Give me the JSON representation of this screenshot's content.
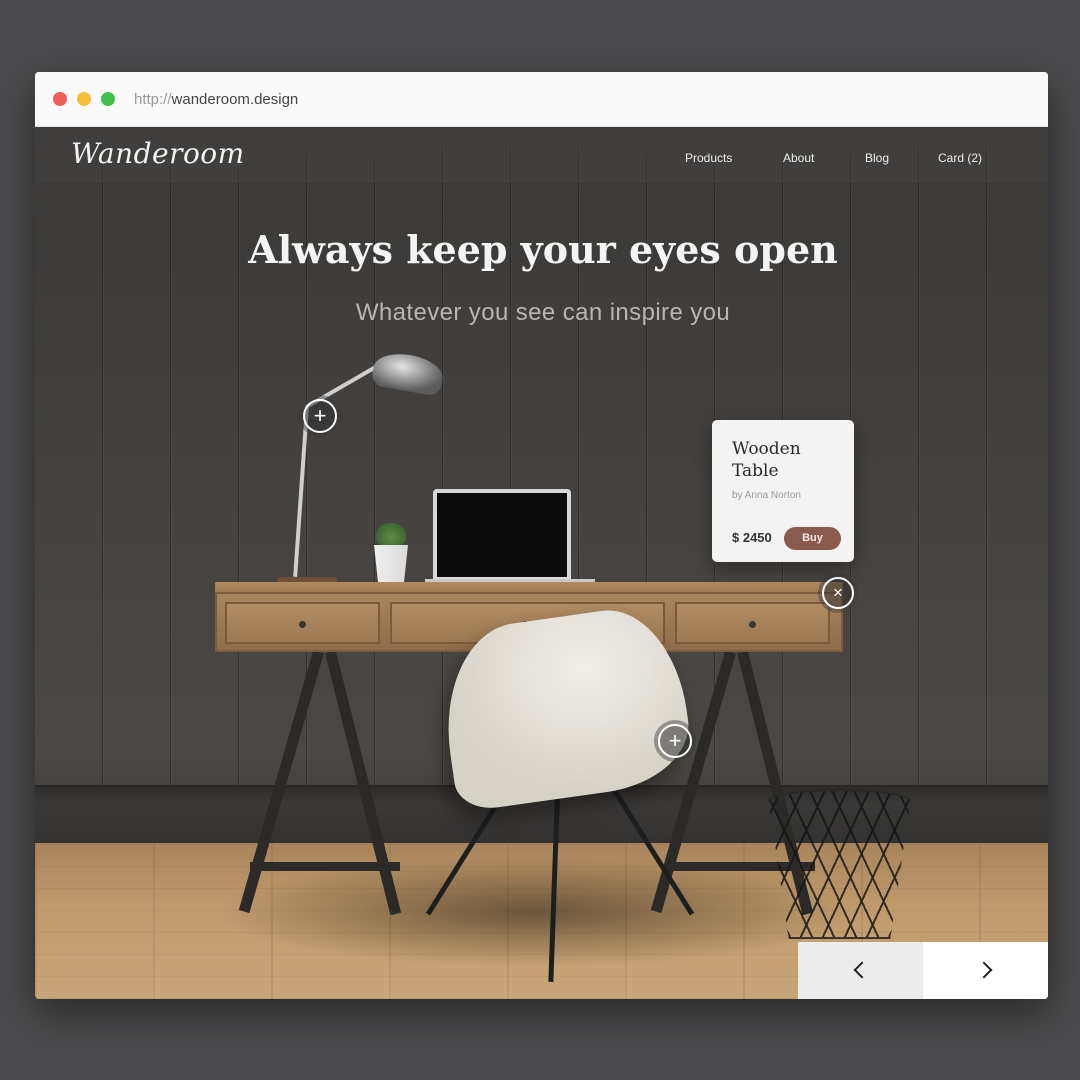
{
  "browser": {
    "url_protocol": "http://",
    "url_domain": "wanderoom.design"
  },
  "site": {
    "logo": "Wanderoom",
    "nav": {
      "products": "Products",
      "about": "About",
      "blog": "Blog",
      "cart": "Card (2)"
    }
  },
  "hero": {
    "title": "Always keep your eyes open",
    "subtitle": "Whatever you see can inspire you"
  },
  "product_card": {
    "title": "Wooden Table",
    "author": "by Anna Norton",
    "price": "$ 2450",
    "buy_label": "Buy"
  },
  "hotspots": {
    "lamp": "+",
    "chair": "+",
    "close": "×"
  },
  "icons": {
    "prev": "chevron-left-icon",
    "next": "chevron-right-icon"
  }
}
